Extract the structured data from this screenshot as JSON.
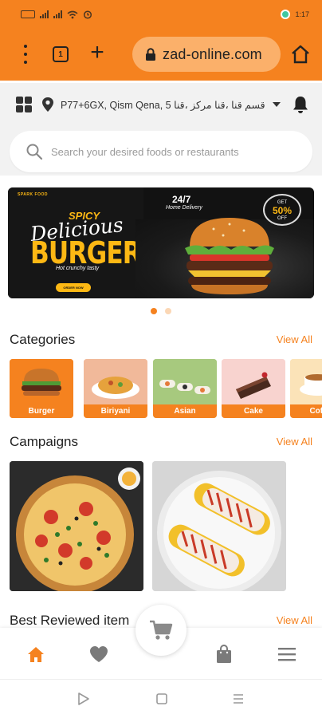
{
  "status_bar": {
    "right_text": "1:17"
  },
  "browser": {
    "tab_count": "1",
    "url": "zad-online.com"
  },
  "location": {
    "address": "P77+6GX, Qism Qena, قسم قنا ،قنا مركز ،قنا 5"
  },
  "search": {
    "placeholder": "Search your desired foods or restaurants"
  },
  "banner": {
    "brand": "SPARK FOOD",
    "line1": "SPICY",
    "line2": "Delicious",
    "line3": "BURGER",
    "tagline": "Hot crunchy tasty",
    "order_label": "ORDER NOW",
    "hours": "24/7",
    "home_delivery": "Home Delivery",
    "badge_top": "GET",
    "badge_value": "50%",
    "badge_bottom": "OFF"
  },
  "carousel": {
    "count": 2,
    "active": 0
  },
  "categories_section": {
    "title": "Categories",
    "view_all": "View All",
    "items": [
      {
        "label": "Burger",
        "bg": "#f5821f"
      },
      {
        "label": "Biriyani",
        "bg": "#f1b99a"
      },
      {
        "label": "Asian",
        "bg": "#a7c97e"
      },
      {
        "label": "Cake",
        "bg": "#f8d3cf"
      },
      {
        "label": "Coffee",
        "bg": "#fbe3b8"
      }
    ]
  },
  "campaigns_section": {
    "title": "Campaigns",
    "view_all": "View All"
  },
  "best_reviewed_section": {
    "title": "Best Reviewed item",
    "view_all": "View All"
  },
  "bottom_nav": {
    "items": [
      "home-icon",
      "heart-icon",
      "cart-icon",
      "bag-icon",
      "menu-icon"
    ],
    "active": "home-icon"
  },
  "colors": {
    "accent": "#f5821f",
    "inactive_icon": "#7a7a7a"
  }
}
